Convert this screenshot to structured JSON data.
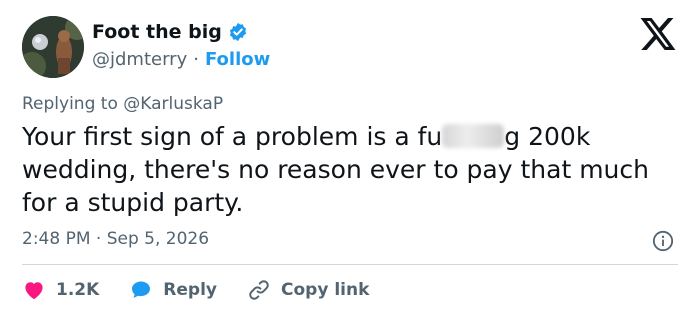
{
  "author": {
    "display_name": "Foot the big",
    "handle": "@jdmterry",
    "separator": "·",
    "follow_label": "Follow"
  },
  "reply": {
    "prefix": "Replying to",
    "mention": "@KarluskaP"
  },
  "tweet": {
    "text_before": "Your first sign of a problem is a fu",
    "text_after": "g 200k wedding, there's no reason ever to pay that much for a stupid party.",
    "timestamp": "2:48 PM · Sep 5, 2026"
  },
  "actions": {
    "like_count": "1.2K",
    "reply_label": "Reply",
    "copy_label": "Copy link"
  },
  "colors": {
    "accent": "#1d9bf0",
    "like": "#f91880",
    "muted": "#536471",
    "text": "#0f1419"
  },
  "icons": {
    "verified": "verified-badge-icon",
    "brand": "x-logo-icon",
    "info": "info-icon",
    "like": "heart-icon",
    "reply": "speech-bubble-icon",
    "copy": "link-icon"
  }
}
